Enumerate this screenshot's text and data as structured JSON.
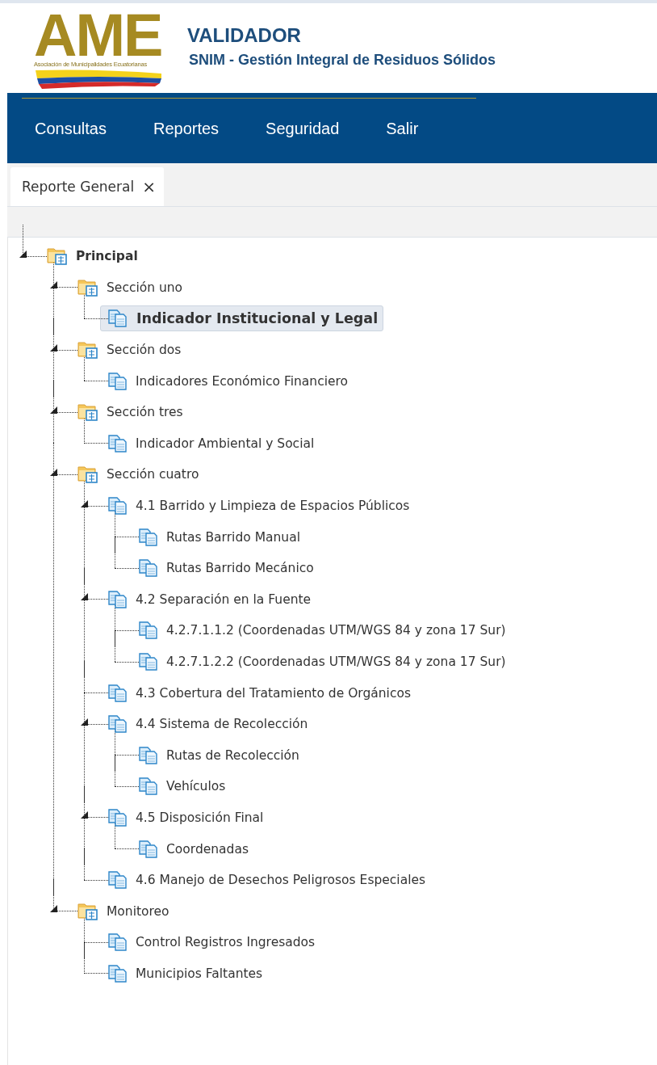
{
  "header": {
    "logo": {
      "letters": "AME",
      "tagline": "Asociación de Municipalidades Ecuatorianas"
    },
    "title": "VALIDADOR",
    "subtitle": "SNIM - Gestión Integral de Residuos Sólidos"
  },
  "menu": [
    {
      "label": "Consultas"
    },
    {
      "label": "Reportes"
    },
    {
      "label": "Seguridad"
    },
    {
      "label": "Salir"
    }
  ],
  "tabs": [
    {
      "label": "Reporte General",
      "selected": true,
      "close": "×"
    }
  ],
  "tree": [
    {
      "label": "Principal",
      "kind": "folder",
      "expanded": true,
      "selected": false,
      "children": [
        {
          "label": "Sección uno",
          "kind": "folder",
          "expanded": true,
          "selected": false,
          "children": [
            {
              "label": "Indicador Institucional y Legal",
              "kind": "document",
              "selected": true
            }
          ]
        },
        {
          "label": "Sección dos",
          "kind": "folder",
          "expanded": true,
          "selected": false,
          "children": [
            {
              "label": "Indicadores Económico Financiero",
              "kind": "document",
              "selected": false
            }
          ]
        },
        {
          "label": "Sección tres",
          "kind": "folder",
          "expanded": true,
          "selected": false,
          "children": [
            {
              "label": "Indicador Ambiental y Social",
              "kind": "document",
              "selected": false
            }
          ]
        },
        {
          "label": "Sección cuatro",
          "kind": "folder",
          "expanded": true,
          "selected": false,
          "children": [
            {
              "label": "4.1 Barrido y Limpieza de Espacios Públicos",
              "kind": "document",
              "expanded": true,
              "selected": false,
              "children": [
                {
                  "label": "Rutas Barrido Manual",
                  "kind": "document",
                  "selected": false
                },
                {
                  "label": "Rutas Barrido Mecánico",
                  "kind": "document",
                  "selected": false
                }
              ]
            },
            {
              "label": "4.2 Separación en la Fuente",
              "kind": "document",
              "expanded": true,
              "selected": false,
              "children": [
                {
                  "label": "4.2.7.1.1.2 (Coordenadas UTM/WGS 84 y zona 17 Sur)",
                  "kind": "document",
                  "selected": false
                },
                {
                  "label": "4.2.7.1.2.2 (Coordenadas UTM/WGS 84 y zona 17 Sur)",
                  "kind": "document",
                  "selected": false
                }
              ]
            },
            {
              "label": "4.3 Cobertura del Tratamiento de Orgánicos",
              "kind": "document",
              "selected": false
            },
            {
              "label": "4.4 Sistema de Recolección",
              "kind": "document",
              "expanded": true,
              "selected": false,
              "children": [
                {
                  "label": "Rutas de Recolección",
                  "kind": "document",
                  "selected": false
                },
                {
                  "label": "Vehículos",
                  "kind": "document",
                  "selected": false
                }
              ]
            },
            {
              "label": "4.5 Disposición Final",
              "kind": "document",
              "expanded": true,
              "selected": false,
              "children": [
                {
                  "label": "Coordenadas",
                  "kind": "document",
                  "selected": false
                }
              ]
            },
            {
              "label": "4.6 Manejo de Desechos Peligrosos Especiales",
              "kind": "document",
              "selected": false
            }
          ]
        },
        {
          "label": "Monitoreo",
          "kind": "folder",
          "expanded": true,
          "selected": false,
          "children": [
            {
              "label": "Control Registros Ingresados",
              "kind": "document",
              "selected": false
            },
            {
              "label": "Municipios Faltantes",
              "kind": "document",
              "selected": false
            }
          ]
        }
      ]
    }
  ]
}
